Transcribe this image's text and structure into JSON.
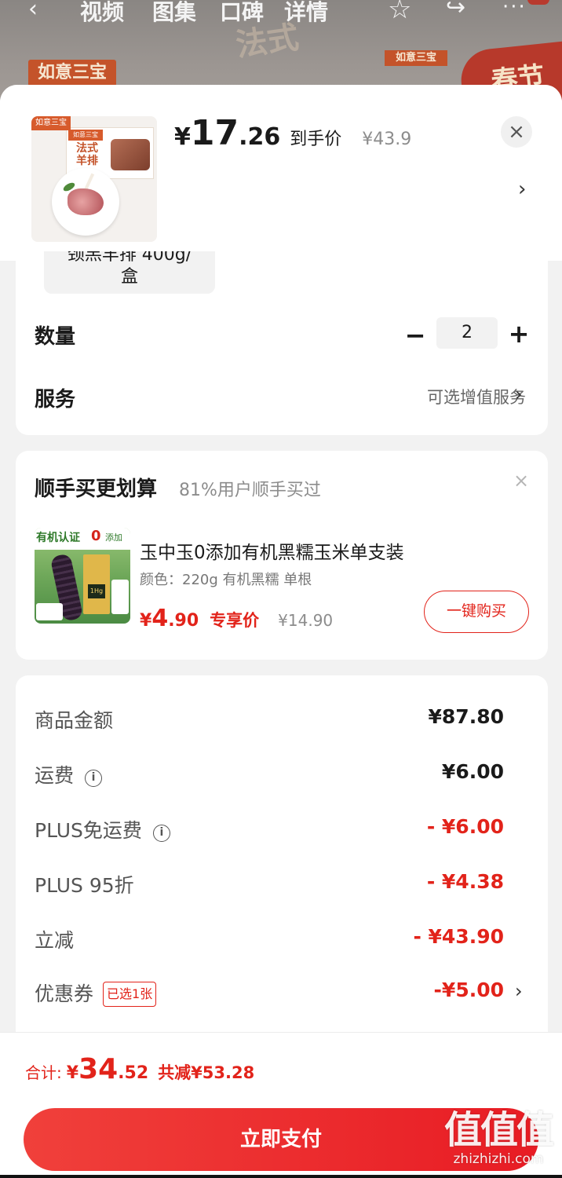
{
  "background": {
    "tabs": [
      "视频",
      "图集",
      "口碑",
      "详情"
    ],
    "brand_tag": "如意三宝",
    "banner_text": "春节"
  },
  "product": {
    "image_brand": "如意三宝",
    "image_title": "法式\n羊排",
    "price_symbol": "¥",
    "price_int": "17",
    "price_dec": ".26",
    "price_label": "到手价",
    "original_price": "¥43.9",
    "close_icon": "×",
    "more_icon": "›"
  },
  "spec": {
    "chip_cut_text": "颈羔羊排 400g/",
    "chip_text": "盒",
    "quantity_label": "数量",
    "quantity_value": "2",
    "minus_symbol": "−",
    "plus_symbol": "+",
    "service_label": "服务",
    "service_value": "可选增值服务",
    "chevron": "›"
  },
  "upsell": {
    "title": "顺手买更划算",
    "subtitle": "81%用户顺手买过",
    "close_icon": "×",
    "image_badge": "有机认证",
    "image_zero": "0",
    "image_add": "添加",
    "name": "玉中玉0添加有机黑糯玉米单支装",
    "spec": "颜色：220g 有机黑糯 单根",
    "price_symbol": "¥",
    "price_int": "4",
    "price_dec": ".90",
    "price_label": "专享价",
    "original_price": "¥14.90",
    "buy_button": "一键购买"
  },
  "summary": {
    "rows": [
      {
        "label": "商品金额",
        "value": "¥87.80"
      },
      {
        "label": "运费",
        "value": "¥6.00"
      },
      {
        "label": "PLUS免运费",
        "value": "- ¥6.00"
      },
      {
        "label": "PLUS 95折",
        "value": "- ¥4.38"
      },
      {
        "label": "立减",
        "value": "- ¥43.90"
      },
      {
        "label": "优惠券",
        "value": "-¥5.00"
      }
    ],
    "info_icon": "i",
    "coupon_tag": "已选1张",
    "chevron": "›"
  },
  "footer": {
    "total_label": "合计:",
    "total_symbol": "¥",
    "total_int": "34",
    "total_dec": ".52",
    "saved_text": "共减¥53.28",
    "pay_button": "立即支付"
  },
  "watermark": {
    "big": "值值值",
    "small": "zhizhizhi.com"
  },
  "colors": {
    "accent_red": "#e2231a",
    "pay_button": "#e81c24"
  }
}
